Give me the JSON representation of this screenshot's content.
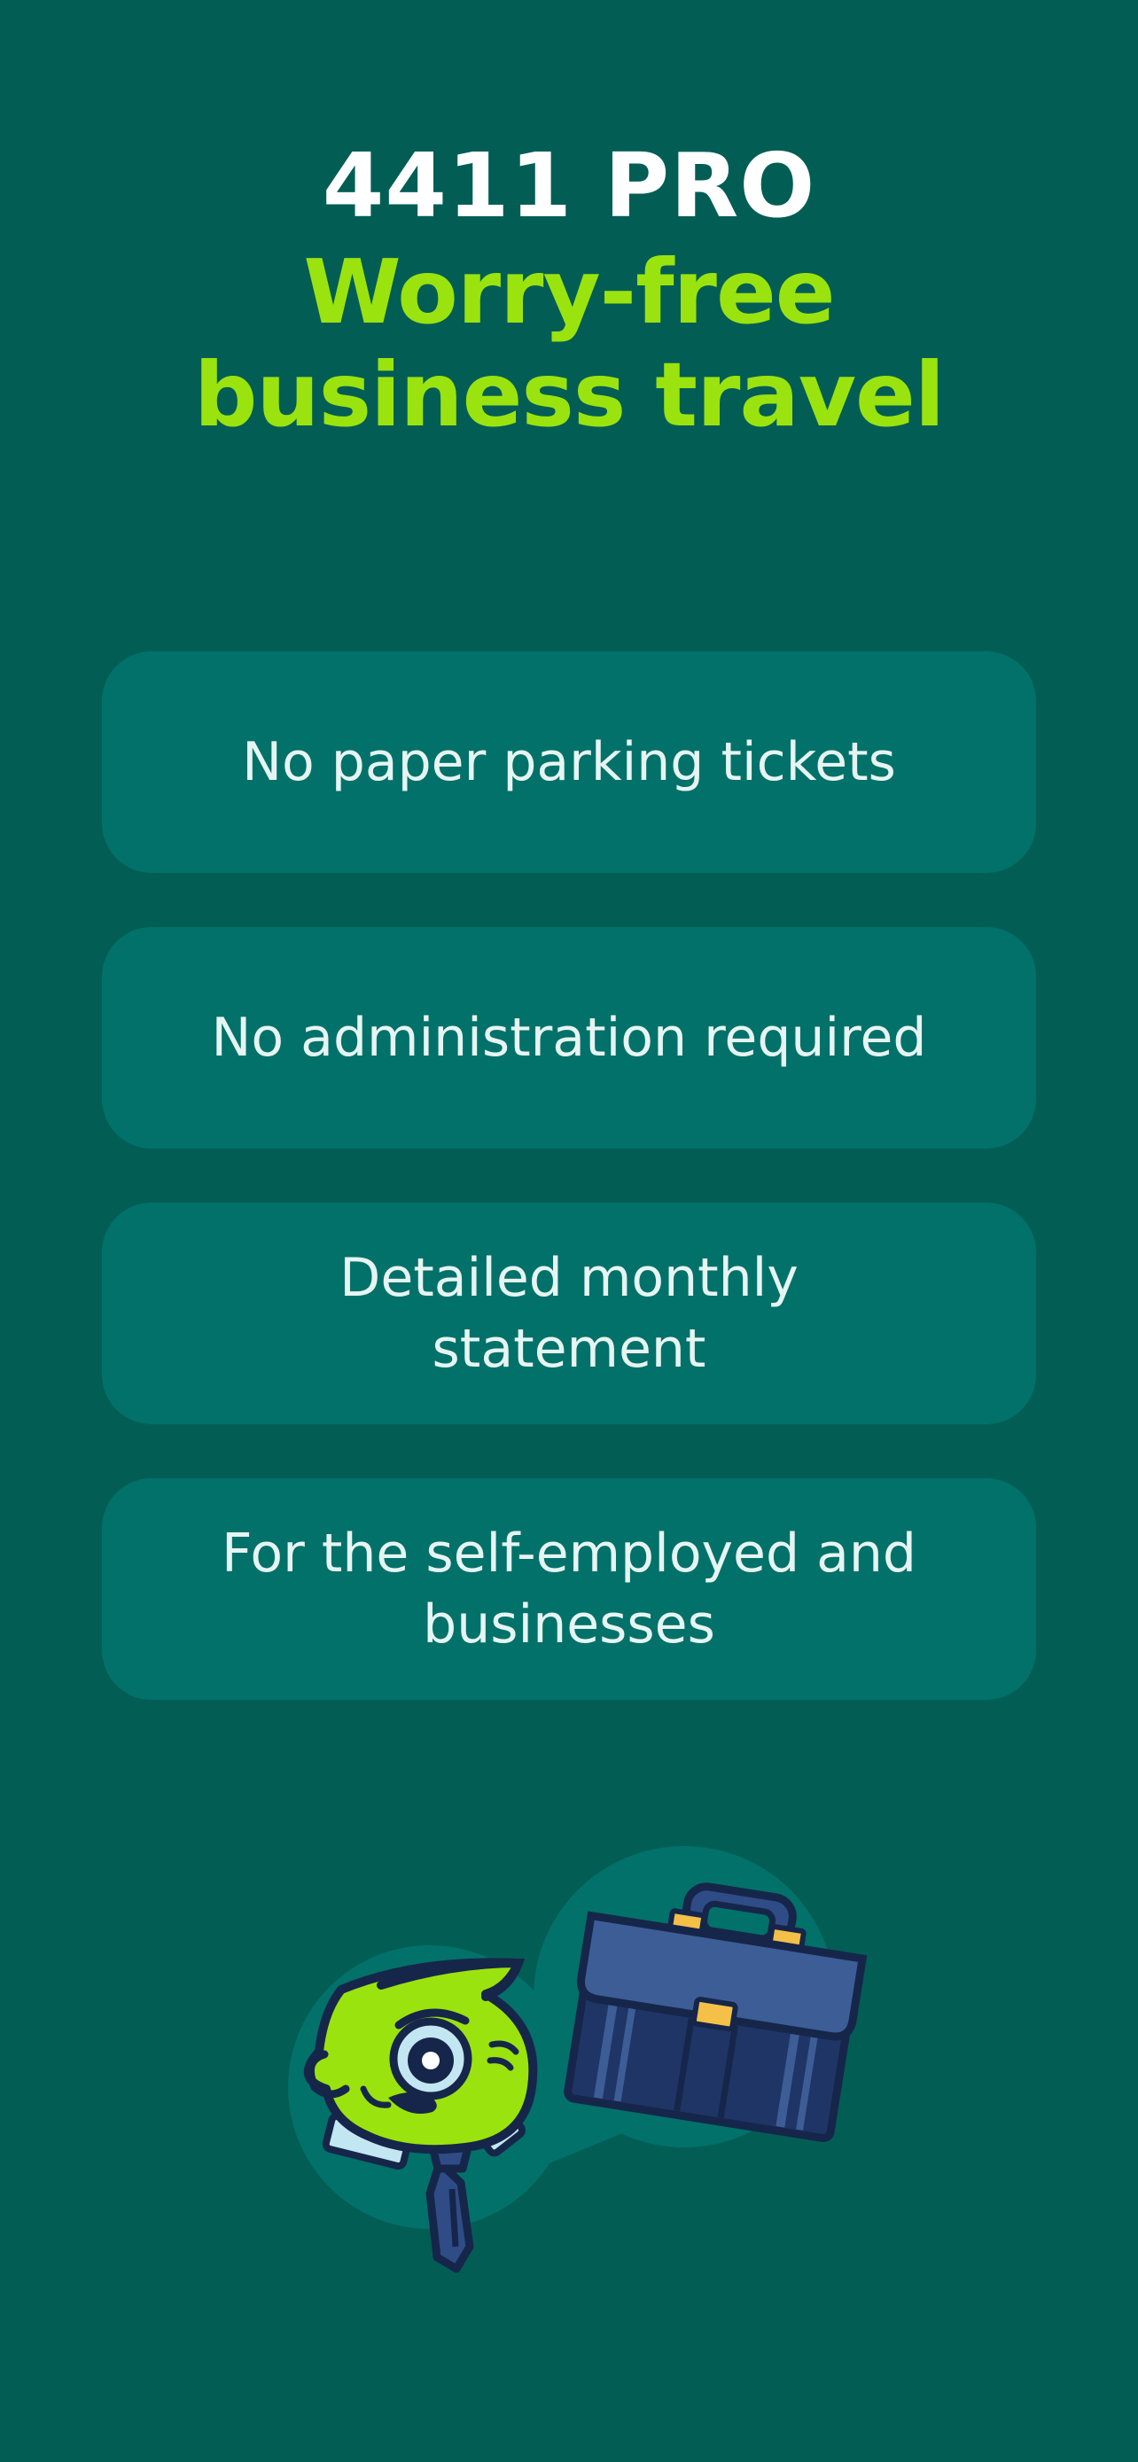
{
  "header": {
    "brand": "4411 PRO",
    "headline_line1": "Worry-free",
    "headline_line2": "business travel"
  },
  "features": [
    {
      "label": "No paper parking tickets"
    },
    {
      "label": "No administration required"
    },
    {
      "label": "Detailed monthly statement"
    },
    {
      "label": "For the self-employed and businesses"
    }
  ],
  "illustration": {
    "icon": "mascot-with-briefcase-icon"
  },
  "colors": {
    "background": "#025e55",
    "card": "#027169",
    "accent_green": "#9be30e",
    "navy": "#16264a"
  }
}
